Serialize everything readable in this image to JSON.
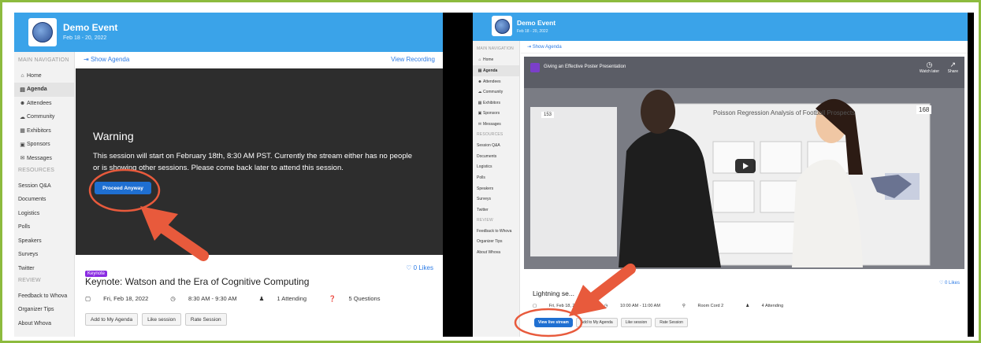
{
  "colors": {
    "accent": "#3aa3e9",
    "border": "#8dbb3e",
    "annotation": "#e85a3c",
    "tag": "#8a2be2",
    "button": "#1f6fd1"
  },
  "left": {
    "event": {
      "title": "Demo Event",
      "date": "Feb 18 - 20, 2022"
    },
    "nav_heading": "Main Navigation",
    "nav": [
      {
        "icon": "home-icon",
        "glyph": "⌂",
        "label": "Home"
      },
      {
        "icon": "agenda-icon",
        "glyph": "▤",
        "label": "Agenda",
        "active": true
      },
      {
        "icon": "attendees-icon",
        "glyph": "☻",
        "label": "Attendees"
      },
      {
        "icon": "community-icon",
        "glyph": "☁",
        "label": "Community"
      },
      {
        "icon": "exhibitors-icon",
        "glyph": "▦",
        "label": "Exhibitors"
      },
      {
        "icon": "sponsors-icon",
        "glyph": "▣",
        "label": "Sponsors"
      },
      {
        "icon": "messages-icon",
        "glyph": "✉",
        "label": "Messages"
      }
    ],
    "res_heading": "Resources",
    "resources": [
      "Session Q&A",
      "Documents",
      "Logistics",
      "Polls",
      "Speakers",
      "Surveys",
      "Twitter"
    ],
    "more_heading": "Review",
    "more": [
      "Feedback to Whova",
      "Organizer Tips",
      "About Whova"
    ],
    "show_agenda": "Show Agenda",
    "view_recording": "View Recording",
    "warning": {
      "title": "Warning",
      "text": "This session will start on February 18th, 8:30 AM PST. Currently the stream either has no people or is showing other sessions. Please come back later to attend this session.",
      "button": "Proceed Anyway"
    },
    "session": {
      "tag": "Keynote",
      "likes": "0 Likes",
      "title": "Keynote: Watson and the Era of Cognitive Computing",
      "date": "Fri, Feb 18, 2022",
      "time": "8:30 AM - 9:30 AM",
      "attending": "1 Attending",
      "questions": "5 Questions",
      "buttons": [
        "Add to My Agenda",
        "Like session",
        "Rate Session"
      ]
    }
  },
  "right": {
    "event": {
      "title": "Demo Event",
      "date": "Feb 18 - 20, 2022"
    },
    "nav_heading": "Main Navigation",
    "nav": [
      {
        "icon": "home-icon",
        "glyph": "⌂",
        "label": "Home"
      },
      {
        "icon": "agenda-icon",
        "glyph": "▤",
        "label": "Agenda",
        "active": true
      },
      {
        "icon": "attendees-icon",
        "glyph": "☻",
        "label": "Attendees"
      },
      {
        "icon": "community-icon",
        "glyph": "☁",
        "label": "Community"
      },
      {
        "icon": "exhibitors-icon",
        "glyph": "▦",
        "label": "Exhibitors"
      },
      {
        "icon": "sponsors-icon",
        "glyph": "▣",
        "label": "Sponsors"
      },
      {
        "icon": "messages-icon",
        "glyph": "✉",
        "label": "Messages"
      }
    ],
    "res_heading": "Resources",
    "resources": [
      "Session Q&A",
      "Documents",
      "Logistics",
      "Polls",
      "Speakers",
      "Surveys",
      "Twitter"
    ],
    "more_heading": "Review",
    "more": [
      "Feedback to Whova",
      "Organizer Tips",
      "About Whova"
    ],
    "show_agenda": "Show Agenda",
    "video": {
      "title": "Giving an Effective Poster Presentation",
      "watch_later": "Watch later",
      "share": "Share",
      "poster_title": "Poisson Regression Analysis of Football Prospects",
      "poster_num_left": "153",
      "poster_num_right": "168"
    },
    "session": {
      "likes": "0 Likes",
      "title": "Lightning se...",
      "date": "Fri, Feb 18, 2022",
      "time": "10:00 AM - 11:00 AM",
      "room": "Room Cord 2",
      "attending": "4 Attending",
      "buttons": [
        "View live stream",
        "Add to My Agenda",
        "Like session",
        "Rate Session"
      ]
    }
  }
}
